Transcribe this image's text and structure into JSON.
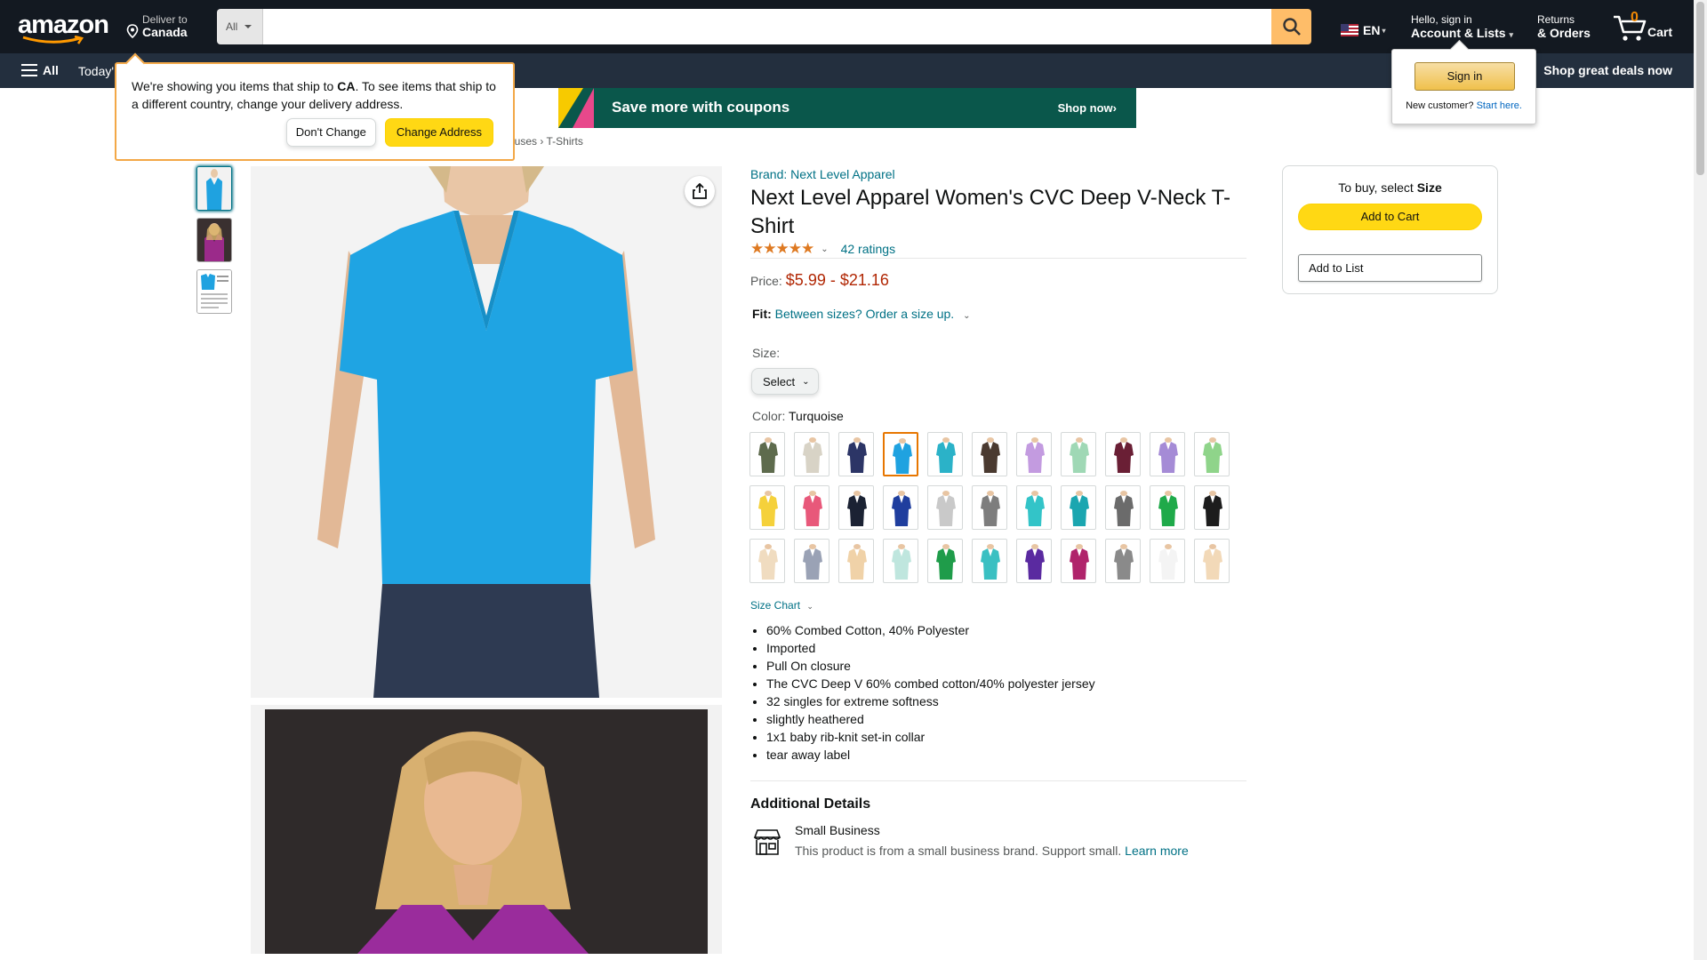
{
  "nav": {
    "logo": "amazon",
    "deliver_line1": "Deliver to",
    "deliver_line2": "Canada",
    "search_category": "All",
    "search_placeholder": "",
    "language": "EN",
    "account_line1": "Hello, sign in",
    "account_line2": "Account & Lists",
    "returns_line1": "Returns",
    "returns_line2": "& Orders",
    "cart_count": "0",
    "cart_label": "Cart",
    "all_label": "All",
    "today_label": "Today'",
    "deals_label": "Shop great deals now"
  },
  "delivery_popover": {
    "text_before": "We're showing you items that ship to ",
    "country": "CA",
    "text_after": ". To see items that ship to a different country, change your delivery address.",
    "dont_change": "Don't Change",
    "change_address": "Change Address"
  },
  "signin_flyout": {
    "button": "Sign in",
    "new_customer": "New customer?",
    "start_here": "Start here."
  },
  "banner": {
    "text": "Save more with coupons",
    "cta": "Shop now›"
  },
  "breadcrumb": {
    "partial": "ouses",
    "sep": "›",
    "current": "T-Shirts"
  },
  "product": {
    "brand": "Brand: Next Level Apparel",
    "title": "Next Level Apparel Women's CVC Deep V-Neck T-Shirt",
    "stars_text": "★★★★★",
    "rating_value": 4.5,
    "ratings_count": "42 ratings",
    "price_label": "Price:",
    "price_range": "$5.99 - $21.16",
    "fit_label": "Fit:",
    "fit_link": "Between sizes? Order a size up.",
    "size_label": "Size:",
    "size_select": "Select",
    "color_label": "Color:",
    "color_value": "Turquoise",
    "size_chart": "Size Chart",
    "bullets": [
      "60% Combed Cotton, 40% Polyester",
      "Imported",
      "Pull On closure",
      "The CVC Deep V 60% combed cotton/40% polyester jersey",
      "32 singles for extreme softness",
      "slightly heathered",
      "1x1 baby rib-knit set-in collar",
      "tear away label"
    ],
    "additional_title": "Additional Details",
    "small_business_title": "Small Business",
    "small_business_desc": "This product is from a small business brand. Support small.",
    "learn_more": "Learn more"
  },
  "swatches": [
    "#5e6b4d",
    "#d8d3c6",
    "#2c3566",
    "#1fa2e0",
    "#2bb2c8",
    "#4a3a30",
    "#c39be0",
    "#9fd8b5",
    "#6a1f35",
    "#a58bd6",
    "#8fd48a",
    "#f5d13b",
    "#e8587a",
    "#1b2233",
    "#1f3e9e",
    "#c9c9c9",
    "#7d7d7d",
    "#33c4c8",
    "#1ba6b0",
    "#6b6b6b",
    "#1faa4a",
    "#1d1d1d",
    "#f0dcc0",
    "#9aa2b5",
    "#f0d2a8",
    "#bfe6de",
    "#1f9c4a",
    "#3ac0c2",
    "#5a2aa0",
    "#b0246b",
    "#8a8a8a",
    "#f4f4f4",
    "#f2d9b8"
  ],
  "selected_swatch": 3,
  "buybox": {
    "to_buy": "To buy, select",
    "size_word": "Size",
    "add_to_cart": "Add to Cart",
    "add_to_list": "Add to List"
  }
}
